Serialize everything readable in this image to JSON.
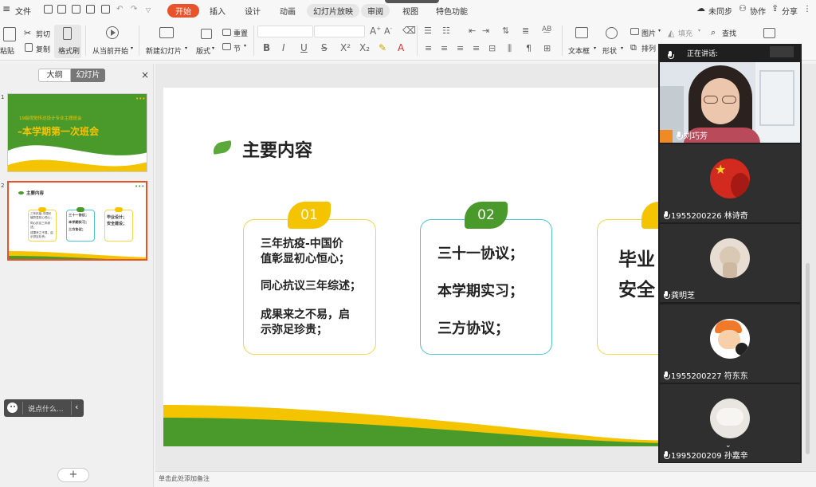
{
  "menu": {
    "file_label": "文件",
    "tabs": [
      "开始",
      "插入",
      "设计",
      "动画",
      "幻灯片放映",
      "审阅",
      "视图",
      "特色功能"
    ],
    "right": {
      "sync": "未同步",
      "collab": "协作",
      "share": "分享"
    }
  },
  "ribbon": {
    "paste": "粘贴",
    "cut": "剪切",
    "copy": "复制",
    "format_painter": "格式刷",
    "play_from_current": "从当前开始",
    "new_slide": "新建幻灯片",
    "layout": "版式",
    "section": "节",
    "reset": "重置",
    "textbox": "文本框",
    "shape": "形状",
    "picture": "图片",
    "fill": "填充",
    "find": "查找",
    "arrange": "排列"
  },
  "panel": {
    "tab_outline": "大纲",
    "tab_slides": "幻灯片",
    "close": "×",
    "add": "+",
    "slides": [
      {
        "num": "1",
        "subtitle": "19级视觉传达设计专业主题班会",
        "title": "–本学期第一次班会"
      },
      {
        "num": "2",
        "heading": "主要内容",
        "c1": [
          "三年抗疫-中国价值彰显初心恒心；",
          "同心抗议三年综述；",
          "成果来之不易，启示弥足珍贵；"
        ],
        "c2": [
          "三十一协议；",
          "本学期实习；",
          "三方协议；"
        ],
        "c3": [
          "毕业设计；",
          "安全建设；"
        ]
      }
    ]
  },
  "slide": {
    "heading": "主要内容",
    "cards": [
      {
        "num": "01",
        "lines": [
          "三年抗疫-中国价",
          "值彰显初心恒心；",
          "同心抗议三年综述；",
          "成果来之不易，启",
          "示弥足珍贵；"
        ]
      },
      {
        "num": "02",
        "lines": [
          "三十一协议；",
          "本学期实习；",
          "三方协议；"
        ]
      },
      {
        "num": "0",
        "lines": [
          "毕业",
          "安全"
        ]
      }
    ]
  },
  "notes": {
    "placeholder": "单击此处添加备注"
  },
  "chat": {
    "placeholder": "说点什么..."
  },
  "meeting": {
    "speaking_label": "正在讲话:",
    "participants": [
      {
        "name": "刘巧芳"
      },
      {
        "name": "1955200226 林诗奇"
      },
      {
        "name": "龚明芝"
      },
      {
        "name": "1955200227 符东东"
      },
      {
        "name": "1995200209 孙嘉辛"
      }
    ]
  },
  "colors": {
    "accent": "#e8532b",
    "slide_green": "#4a9a2b",
    "slide_yellow": "#f5c400",
    "card_border_yellow": "#f5d54a",
    "card_border_cyan": "#4cc6d6"
  }
}
